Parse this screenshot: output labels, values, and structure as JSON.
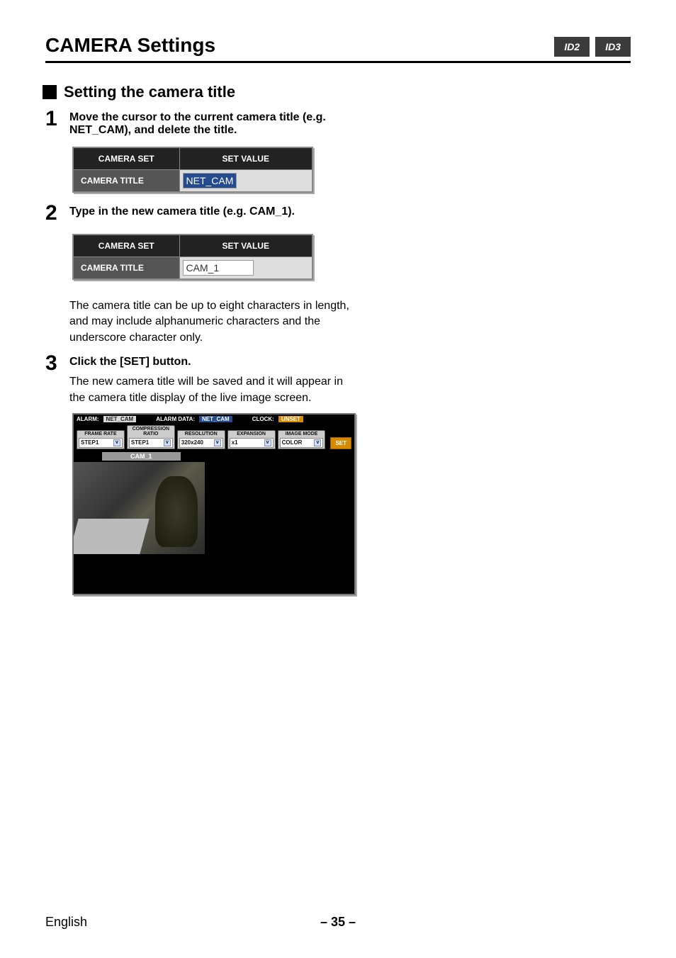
{
  "header": {
    "title": "CAMERA Settings",
    "tags": [
      "ID2",
      "ID3"
    ]
  },
  "section": {
    "heading": "Setting the camera title"
  },
  "steps": [
    {
      "num": "1",
      "bold": "Move the cursor to the current camera title (e.g. NET_CAM), and delete the title.",
      "table": {
        "h1": "CAMERA SET",
        "h2": "SET VALUE",
        "row_label": "CAMERA TITLE",
        "row_value": "NET_CAM",
        "highlight": true
      }
    },
    {
      "num": "2",
      "bold": "Type in the new camera title (e.g. CAM_1).",
      "table": {
        "h1": "CAMERA SET",
        "h2": "SET VALUE",
        "row_label": "CAMERA TITLE",
        "row_value": "CAM_1",
        "highlight": false
      },
      "para": "The camera title can be up to eight characters in length, and may include alphanumeric characters and the underscore character only."
    },
    {
      "num": "3",
      "bold": "Click the [SET] button.",
      "para": "The new camera title will be saved and it will appear in the camera title display of the live image screen."
    }
  ],
  "live": {
    "topbar": {
      "alarm_label": "ALARM:",
      "alarm_value": "NET_CAM",
      "alarmdata_label": "ALARM DATA:",
      "alarmdata_value": "NET_CAM",
      "clock_label": "CLOCK:",
      "clock_value": "UNSET"
    },
    "controls": [
      {
        "label": "FRAME RATE",
        "value": "STEP1"
      },
      {
        "label": "COMPRESSION RATIO",
        "value": "STEP1"
      },
      {
        "label": "RESOLUTION",
        "value": "320x240"
      },
      {
        "label": "EXPANSION",
        "value": "x1"
      },
      {
        "label": "IMAGE MODE",
        "value": "COLOR"
      }
    ],
    "set_button": "SET",
    "cam_label": "CAM_1"
  },
  "footer": {
    "lang": "English",
    "page": "– 35 –"
  }
}
